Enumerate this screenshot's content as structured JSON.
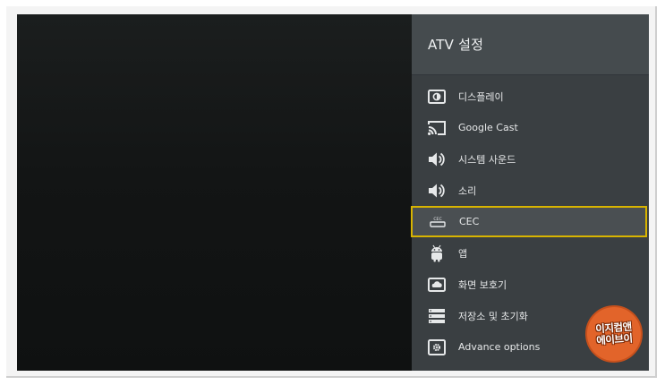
{
  "settings_panel": {
    "title": "ATV 설정",
    "items": [
      {
        "label": "디스플레이",
        "icon": "display-icon"
      },
      {
        "label": "Google Cast",
        "icon": "cast-icon"
      },
      {
        "label": "시스템 사운드",
        "icon": "speaker-icon"
      },
      {
        "label": "소리",
        "icon": "speaker-icon"
      },
      {
        "label": "CEC",
        "icon": "cec-icon",
        "selected": true
      },
      {
        "label": "앱",
        "icon": "android-icon"
      },
      {
        "label": "화면 보호기",
        "icon": "cloud-icon"
      },
      {
        "label": "저장소 및 초기화",
        "icon": "storage-icon"
      },
      {
        "label": "Advance options",
        "icon": "gear-icon"
      }
    ]
  },
  "watermark": {
    "line1": "이지컴앤",
    "line2": "에이브이"
  },
  "colors": {
    "panel_bg": "#3a3f42",
    "header_bg": "#454b4e",
    "selection_border": "#d8b400",
    "watermark_bg": "#e2642a"
  }
}
